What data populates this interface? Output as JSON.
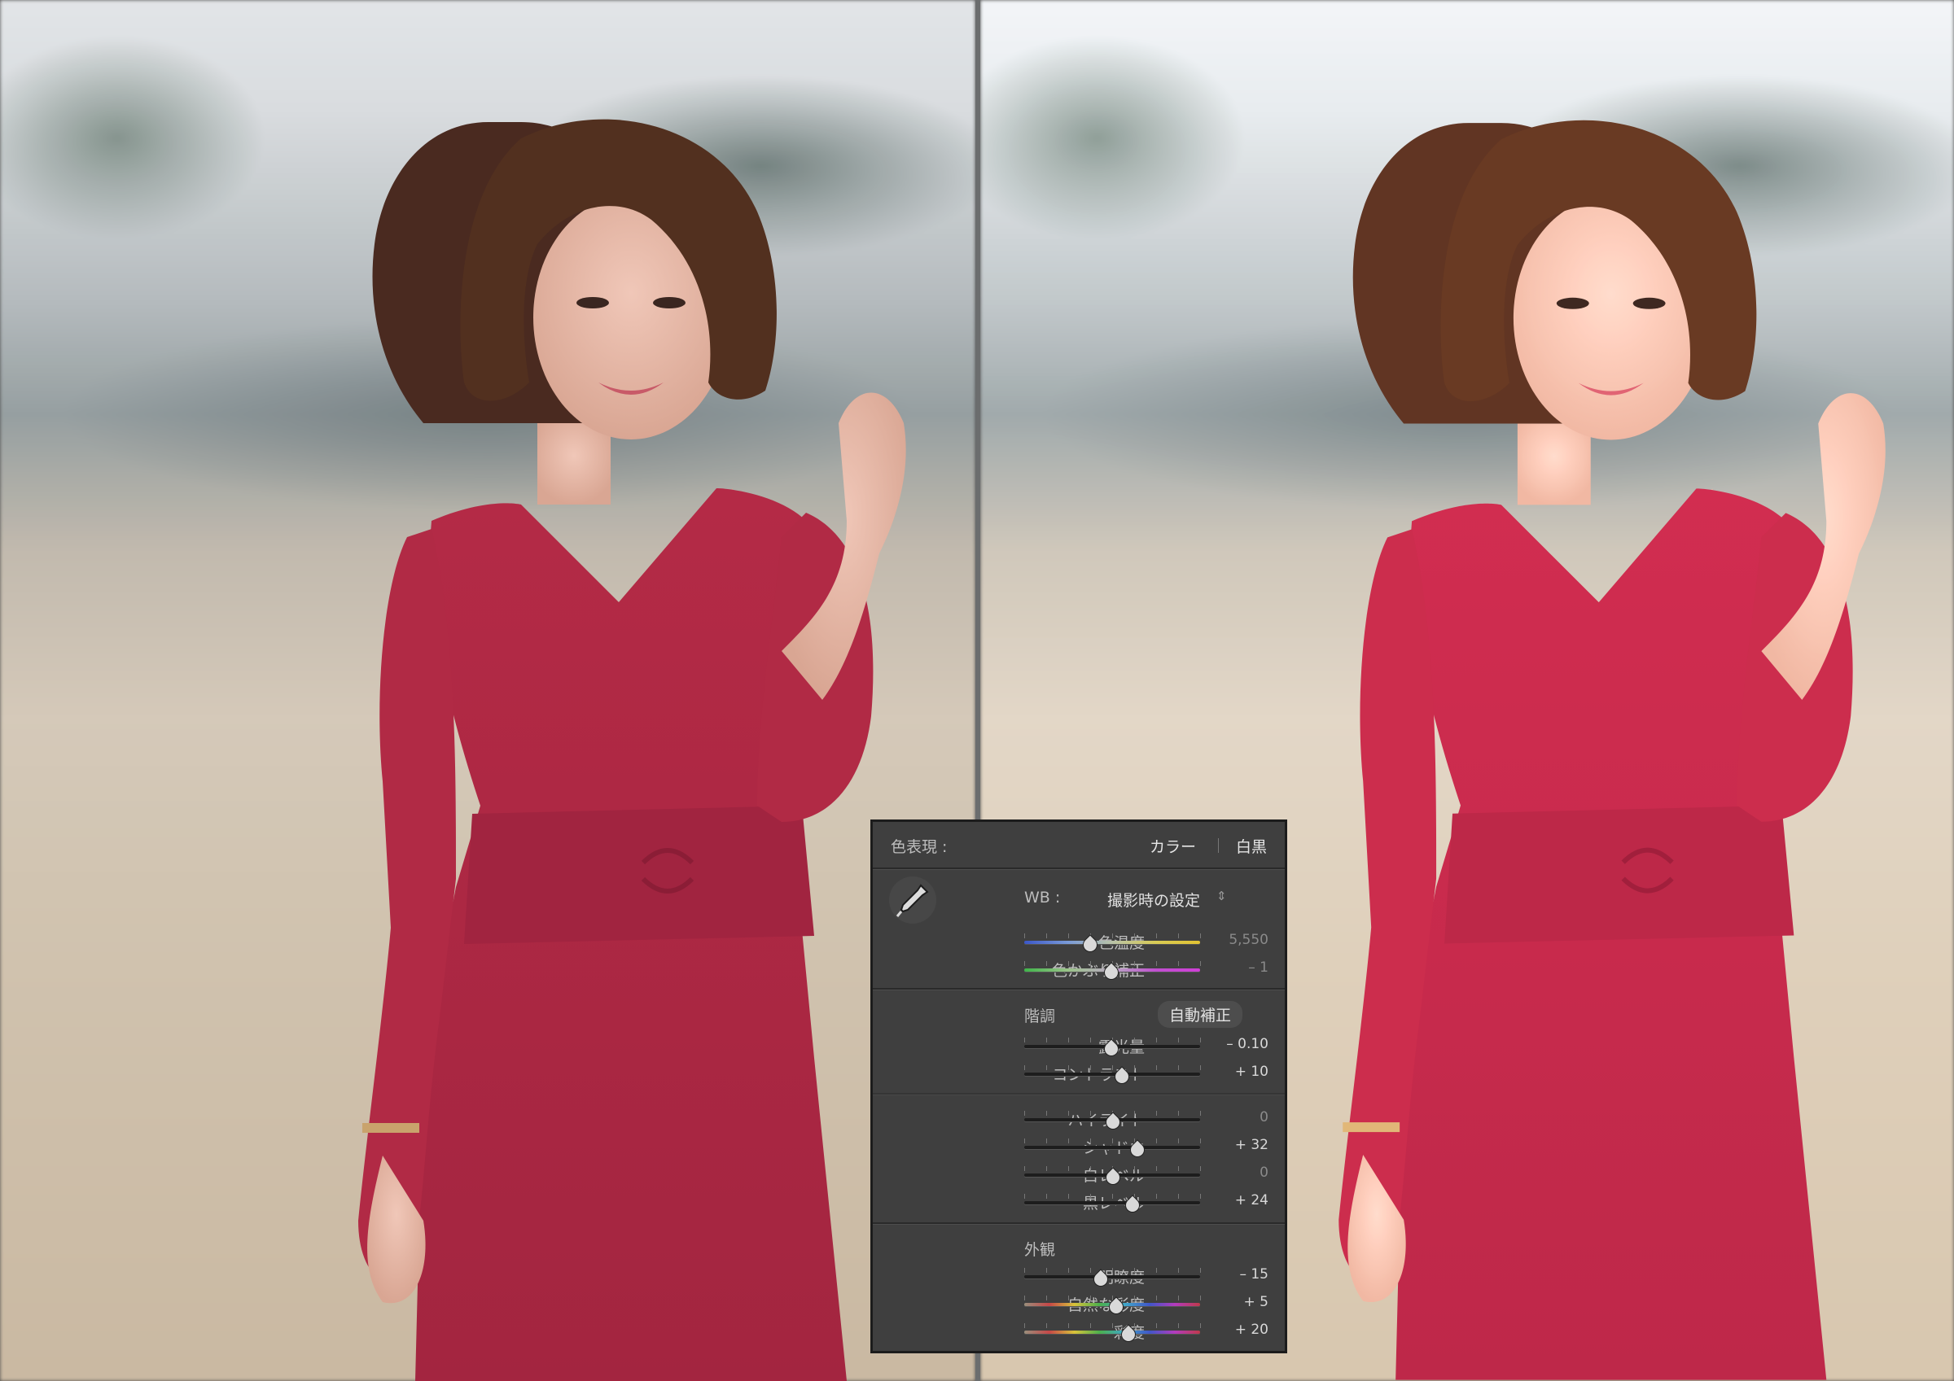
{
  "panel": {
    "treatment_label": "色表現 :",
    "treatment_options": [
      "カラー",
      "白黒"
    ],
    "wb_label": "WB :",
    "wb_value": "撮影時の設定",
    "wb_value_arrows": "⇕",
    "tone_label": "階調",
    "auto_label": "自動補正",
    "presence_label": "外観",
    "wb_sliders": [
      {
        "label": "色温度",
        "value": "5,550",
        "position": 0.37,
        "track": "temp"
      },
      {
        "label": "色かぶり補正",
        "value": "– 1",
        "position": 0.49,
        "track": "tint"
      }
    ],
    "tone_sliders": [
      {
        "label": "露光量",
        "value": "– 0.10",
        "position": 0.49
      },
      {
        "label": "コントラスト",
        "value": "+ 10",
        "position": 0.55
      }
    ],
    "region_sliders": [
      {
        "label": "ハイライト",
        "value": "0",
        "position": 0.5
      },
      {
        "label": "シャドウ",
        "value": "+ 32",
        "position": 0.64
      },
      {
        "label": "白レベル",
        "value": "0",
        "position": 0.5
      },
      {
        "label": "黒レベル",
        "value": "+ 24",
        "position": 0.61
      }
    ],
    "presence_sliders": [
      {
        "label": "明瞭度",
        "value": "– 15",
        "position": 0.43,
        "track": "gray"
      },
      {
        "label": "自然な彩度",
        "value": "+ 5",
        "position": 0.52,
        "track": "color"
      },
      {
        "label": "彩度",
        "value": "+ 20",
        "position": 0.59,
        "track": "color"
      }
    ]
  },
  "colors": {
    "panel_bg": "#3f3f3f",
    "dress": "#b22a45",
    "divider": "#6b6d6e"
  },
  "icons": {
    "eyedropper": "eyedropper-icon",
    "dropdown": "updown-arrows-icon"
  }
}
